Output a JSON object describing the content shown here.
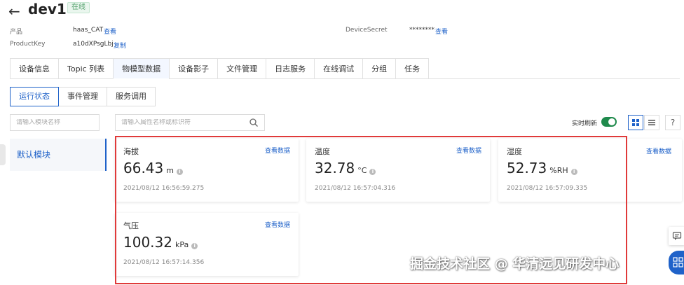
{
  "header": {
    "title": "dev1",
    "status": "在线"
  },
  "meta": {
    "product_label": "产品",
    "product_value": "haas_CAT",
    "product_link": "查看",
    "productkey_label": "ProductKey",
    "productkey_value": "a10dXPsgLbj",
    "productkey_link": "复制",
    "secret_label": "DeviceSecret",
    "secret_value": "********",
    "secret_link": "查看"
  },
  "tabs": [
    {
      "label": "设备信息"
    },
    {
      "label": "Topic 列表"
    },
    {
      "label": "物模型数据"
    },
    {
      "label": "设备影子"
    },
    {
      "label": "文件管理"
    },
    {
      "label": "日志服务"
    },
    {
      "label": "在线调试"
    },
    {
      "label": "分组"
    },
    {
      "label": "任务"
    }
  ],
  "subtabs": [
    {
      "label": "运行状态"
    },
    {
      "label": "事件管理"
    },
    {
      "label": "服务调用"
    }
  ],
  "module_search": {
    "placeholder": "请输入模块名称"
  },
  "property_search": {
    "placeholder": "请输入属性名称或标识符"
  },
  "modules": [
    {
      "label": "默认模块"
    }
  ],
  "toolbar": {
    "refresh_label": "实时刷新",
    "help": "?"
  },
  "cards": [
    {
      "name": "海拔",
      "link": "查看数据",
      "value": "66.43",
      "unit": "m",
      "time": "2021/08/12 16:56:59.275"
    },
    {
      "name": "温度",
      "link": "查看数据",
      "value": "32.78",
      "unit": "°C",
      "time": "2021/08/12 16:57:04.316"
    },
    {
      "name": "湿度",
      "link": "查看数据",
      "value": "52.73",
      "unit": "%RH",
      "time": "2021/08/12 16:57:09.335"
    },
    {
      "name": "气压",
      "link": "查看数据",
      "value": "100.32",
      "unit": "kPa",
      "time": "2021/08/12 16:57:14.356"
    }
  ],
  "extra_card_link": "查看数据",
  "watermark": "掘金技术社区 @ 华清远见研发中心",
  "colors": {
    "accent": "#1f62c9",
    "online": "#52a06b",
    "highlight": "#e03a3a"
  }
}
